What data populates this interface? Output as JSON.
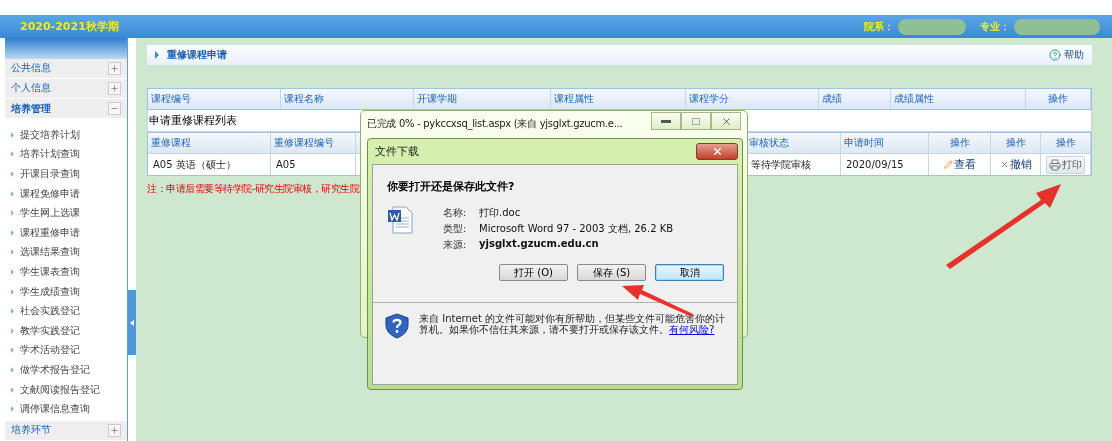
{
  "header": {
    "semester": "2020-2021秋学期",
    "fields": [
      {
        "label": "院系："
      },
      {
        "label": "专业："
      }
    ]
  },
  "sidebar": {
    "sections": [
      {
        "label": "公共信息",
        "expanded": false
      },
      {
        "label": "个人信息",
        "expanded": false
      },
      {
        "label": "培养管理",
        "expanded": true,
        "children": [
          "提交培养计划",
          "培养计划查询",
          "开课目录查询",
          "课程免修申请",
          "学生网上选课",
          "课程重修申请",
          "选课结果查询",
          "学生课表查询",
          "学生成绩查询",
          "社会实践登记",
          "教学实践登记",
          "学术活动登记",
          "做学术报告登记",
          "文献阅读报告登记",
          "调停课信息查询"
        ]
      },
      {
        "label": "培养环节",
        "expanded": false
      }
    ]
  },
  "page_title": "重修课程申请",
  "help": "帮助",
  "course_table": {
    "columns": [
      "课程编号",
      "课程名称",
      "开课学期",
      "课程属性",
      "课程学分",
      "成绩",
      "成绩属性",
      "操作"
    ]
  },
  "list_title": "申请重修课程列表",
  "request_table": {
    "columns_left": [
      "重修课程",
      "重修课程编号"
    ],
    "columns_right": [
      "审核状态",
      "申请时间",
      "操作",
      "操作",
      "操作"
    ],
    "rows": [
      {
        "course": "A05 英语（硕士）",
        "code": "A05",
        "status": "等待学院审核",
        "date": "2020/09/15",
        "actions": [
          {
            "kind": "view",
            "label": "查看"
          },
          {
            "kind": "cancel",
            "label": "撤销"
          },
          {
            "kind": "print",
            "label": "打印"
          }
        ]
      }
    ]
  },
  "note": "注：申请后需要等待学院-研究生院审核，研究生院",
  "browser_window": {
    "title": "已完成 0% - pykccxsq_list.aspx (来自 yjsglxt.gzucm.e..."
  },
  "download_dialog": {
    "title": "文件下载",
    "question": "你要打开还是保存此文件?",
    "details": [
      {
        "label": "名称:",
        "value": "打印.doc",
        "bold": false
      },
      {
        "label": "类型:",
        "value": "Microsoft Word 97 - 2003 文档, 26.2 KB",
        "bold": false
      },
      {
        "label": "来源:",
        "value": "yjsglxt.gzucm.edu.cn",
        "bold": true
      }
    ],
    "buttons": [
      {
        "label": "打开 (O)",
        "selected": false
      },
      {
        "label": "保存 (S)",
        "selected": false
      },
      {
        "label": "取消",
        "selected": true
      }
    ],
    "warning": "来自 Internet 的文件可能对你有所帮助，但某些文件可能危害你的计算机。如果你不信任其来源，请不要打开或保存该文件。",
    "link": "有何风险?"
  }
}
